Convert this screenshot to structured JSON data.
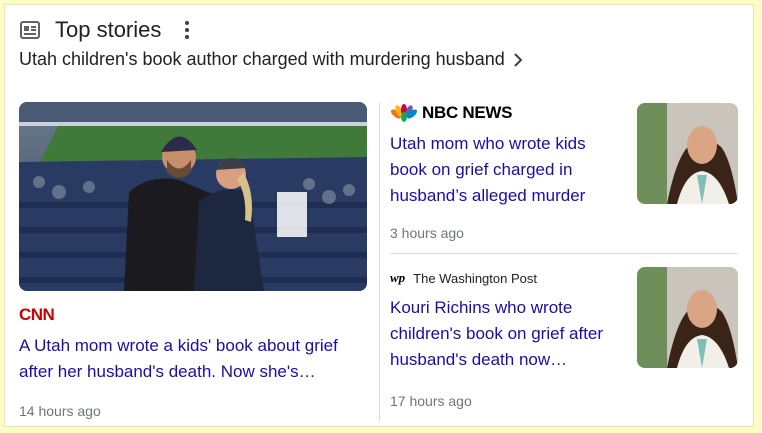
{
  "section": {
    "title": "Top stories",
    "topic": "Utah children's book author charged with murdering husband"
  },
  "icons": {
    "news": "newspaper-icon",
    "more": "more-vert-icon",
    "chevron": "chevron-right-icon"
  },
  "colors": {
    "headline": "#1a0dab",
    "cnn": "#cc0000",
    "meta": "#70757a"
  },
  "stories": {
    "main": {
      "source": "CNN",
      "headline_line1": "A Utah mom wrote a kids' book about grief",
      "headline_line2": "after her husband's death. Now she's…",
      "time": "14 hours ago"
    },
    "nbc": {
      "source": "NBC NEWS",
      "headline_line1": "Utah mom who wrote kids",
      "headline_line2": "book on grief charged in",
      "headline_line3": "husband’s alleged murder",
      "time": "3 hours ago"
    },
    "wapo": {
      "source_logo": "wp",
      "source": "The Washington Post",
      "headline_line1": "Kouri Richins who wrote",
      "headline_line2": "children's book on grief after",
      "headline_line3": "husband's death now…",
      "time": "17 hours ago"
    }
  }
}
